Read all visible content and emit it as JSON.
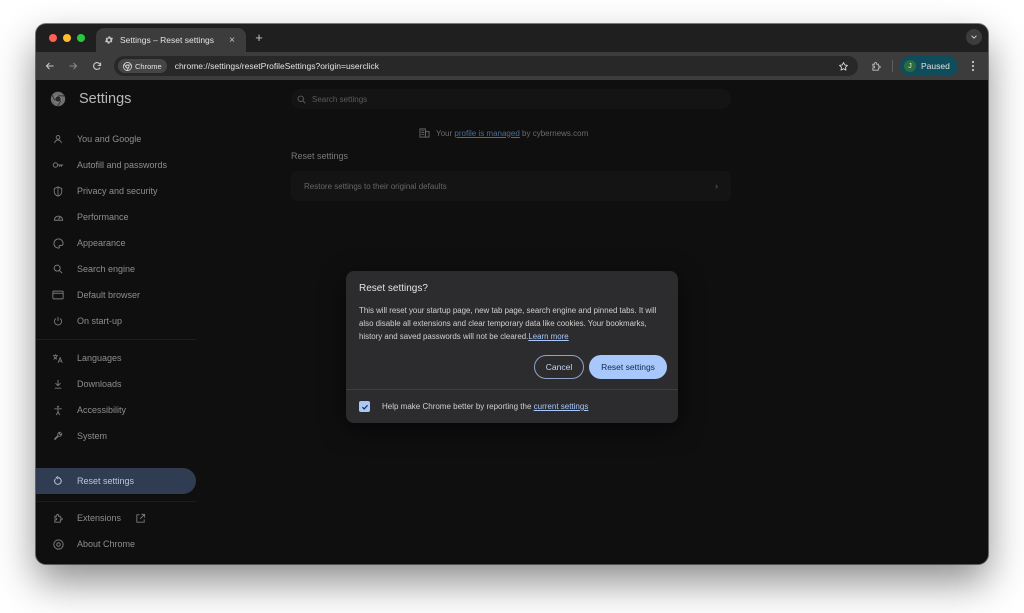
{
  "browser": {
    "tab_title": "Settings – Reset settings",
    "tab_close": "×",
    "new_tab": "+",
    "chip_label": "Chrome",
    "url": "chrome://settings/resetProfileSettings?origin=userclick",
    "profile_initial": "J",
    "profile_label": "Paused"
  },
  "header": {
    "title": "Settings",
    "search_placeholder": "Search settings"
  },
  "sidebar": {
    "items": [
      {
        "label": "You and Google",
        "icon": "person-icon"
      },
      {
        "label": "Autofill and passwords",
        "icon": "key-icon"
      },
      {
        "label": "Privacy and security",
        "icon": "shield-icon"
      },
      {
        "label": "Performance",
        "icon": "speedometer-icon"
      },
      {
        "label": "Appearance",
        "icon": "palette-icon"
      },
      {
        "label": "Search engine",
        "icon": "search-icon"
      },
      {
        "label": "Default browser",
        "icon": "browser-window-icon"
      },
      {
        "label": "On start-up",
        "icon": "power-icon"
      },
      {
        "label": "Languages",
        "icon": "translate-icon"
      },
      {
        "label": "Downloads",
        "icon": "download-icon"
      },
      {
        "label": "Accessibility",
        "icon": "accessibility-icon"
      },
      {
        "label": "System",
        "icon": "wrench-icon"
      },
      {
        "label": "Reset settings",
        "icon": "reset-icon",
        "active": true
      },
      {
        "label": "Extensions",
        "icon": "puzzle-icon"
      },
      {
        "label": "About Chrome",
        "icon": "chrome-icon"
      }
    ]
  },
  "main": {
    "managed_prefix": "Your",
    "managed_link": "profile is managed",
    "managed_suffix": "by cybernews.com",
    "section_title": "Reset settings",
    "restore_label": "Restore settings to their original defaults",
    "restore_arrow": "›"
  },
  "dialog": {
    "title": "Reset settings?",
    "body": "This will reset your startup page, new tab page, search engine and pinned tabs. It will also disable all extensions and clear temporary data like cookies. Your bookmarks, history and saved passwords will not be cleared.",
    "learn_more": "Learn more",
    "cancel_label": "Cancel",
    "reset_label": "Reset settings",
    "checkbox_checked": true,
    "checkbox_label_prefix": "Help make Chrome better by reporting the",
    "checkbox_link": "current settings"
  },
  "colors": {
    "accent": "#a8c7fa",
    "active_nav_bg": "#2f3c52",
    "profile_bg": "#0f4c5c",
    "dialog_bg": "#2c2c2e"
  }
}
